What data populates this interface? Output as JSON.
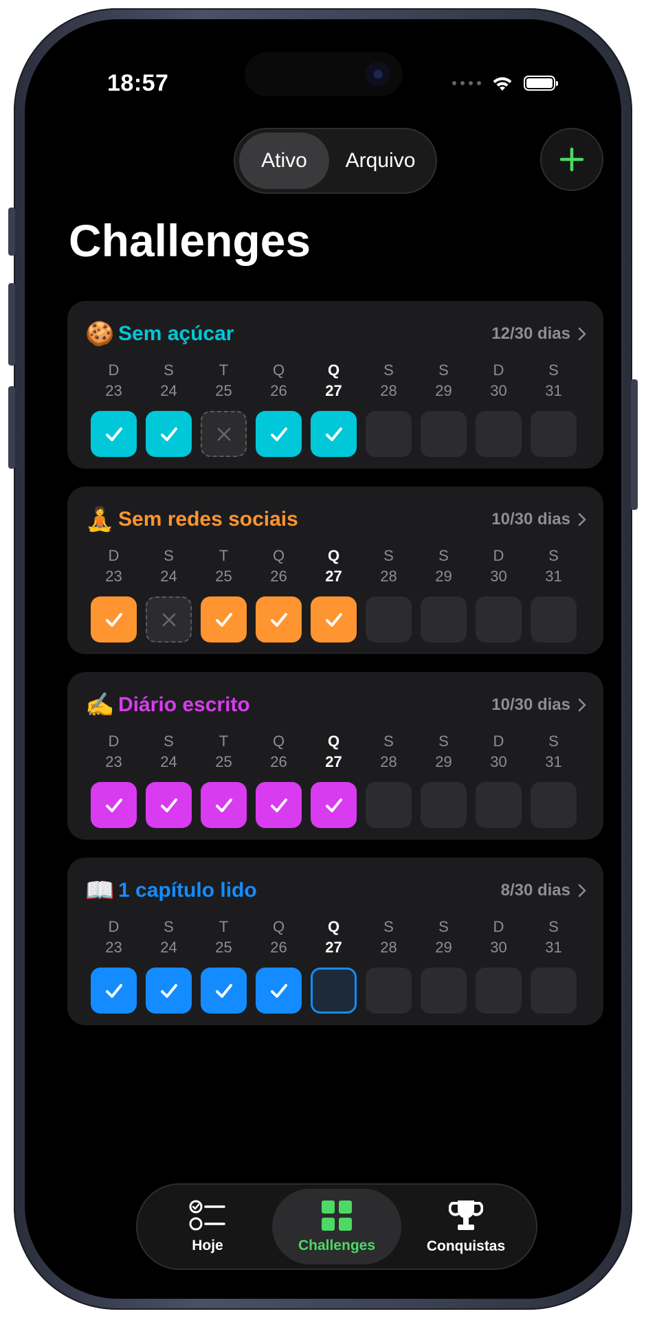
{
  "status_bar": {
    "time": "18:57"
  },
  "segmented": {
    "active_label": "Ativo",
    "archive_label": "Arquivo"
  },
  "page": {
    "title": "Challenges"
  },
  "colors": {
    "accent_green": "#4cd964",
    "cyan": "#00c8d8",
    "orange": "#ff9530",
    "magenta": "#d93bf0",
    "blue": "#148cff"
  },
  "challenges": [
    {
      "emoji": "🍪",
      "name": "Sem açúcar",
      "progress": "12/30 dias",
      "color": "#00c8d8",
      "days": [
        {
          "letter": "D",
          "num": "23",
          "state": "done"
        },
        {
          "letter": "S",
          "num": "24",
          "state": "done"
        },
        {
          "letter": "T",
          "num": "25",
          "state": "missed"
        },
        {
          "letter": "Q",
          "num": "26",
          "state": "done"
        },
        {
          "letter": "Q",
          "num": "27",
          "state": "done",
          "today": true
        },
        {
          "letter": "S",
          "num": "28",
          "state": "empty"
        },
        {
          "letter": "S",
          "num": "29",
          "state": "empty"
        },
        {
          "letter": "D",
          "num": "30",
          "state": "empty"
        },
        {
          "letter": "S",
          "num": "31",
          "state": "empty"
        }
      ]
    },
    {
      "emoji": "🧘",
      "name": "Sem redes sociais",
      "progress": "10/30 dias",
      "color": "#ff9530",
      "days": [
        {
          "letter": "D",
          "num": "23",
          "state": "done"
        },
        {
          "letter": "S",
          "num": "24",
          "state": "missed"
        },
        {
          "letter": "T",
          "num": "25",
          "state": "done"
        },
        {
          "letter": "Q",
          "num": "26",
          "state": "done"
        },
        {
          "letter": "Q",
          "num": "27",
          "state": "done",
          "today": true
        },
        {
          "letter": "S",
          "num": "28",
          "state": "empty"
        },
        {
          "letter": "S",
          "num": "29",
          "state": "empty"
        },
        {
          "letter": "D",
          "num": "30",
          "state": "empty"
        },
        {
          "letter": "S",
          "num": "31",
          "state": "empty"
        }
      ]
    },
    {
      "emoji": "✍️",
      "name": "Diário escrito",
      "progress": "10/30 dias",
      "color": "#d93bf0",
      "days": [
        {
          "letter": "D",
          "num": "23",
          "state": "done"
        },
        {
          "letter": "S",
          "num": "24",
          "state": "done"
        },
        {
          "letter": "T",
          "num": "25",
          "state": "done"
        },
        {
          "letter": "Q",
          "num": "26",
          "state": "done"
        },
        {
          "letter": "Q",
          "num": "27",
          "state": "done",
          "today": true
        },
        {
          "letter": "S",
          "num": "28",
          "state": "empty"
        },
        {
          "letter": "S",
          "num": "29",
          "state": "empty"
        },
        {
          "letter": "D",
          "num": "30",
          "state": "empty"
        },
        {
          "letter": "S",
          "num": "31",
          "state": "empty"
        }
      ]
    },
    {
      "emoji": "📖",
      "name": "1 capítulo lido",
      "progress": "8/30 dias",
      "color": "#148cff",
      "days": [
        {
          "letter": "D",
          "num": "23",
          "state": "done"
        },
        {
          "letter": "S",
          "num": "24",
          "state": "done"
        },
        {
          "letter": "T",
          "num": "25",
          "state": "done"
        },
        {
          "letter": "Q",
          "num": "26",
          "state": "done"
        },
        {
          "letter": "Q",
          "num": "27",
          "state": "pending",
          "today": true
        },
        {
          "letter": "S",
          "num": "28",
          "state": "empty"
        },
        {
          "letter": "S",
          "num": "29",
          "state": "empty"
        },
        {
          "letter": "D",
          "num": "30",
          "state": "empty"
        },
        {
          "letter": "S",
          "num": "31",
          "state": "empty"
        }
      ]
    }
  ],
  "tabbar": {
    "today_label": "Hoje",
    "challenges_label": "Challenges",
    "achievements_label": "Conquistas"
  }
}
